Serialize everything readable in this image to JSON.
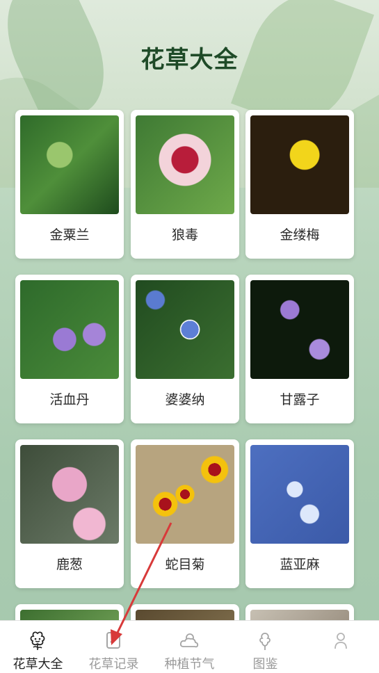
{
  "header": {
    "title": "花草大全"
  },
  "plants": [
    {
      "name": "金粟兰"
    },
    {
      "name": "狼毒"
    },
    {
      "name": "金缕梅"
    },
    {
      "name": "活血丹"
    },
    {
      "name": "婆婆纳"
    },
    {
      "name": "甘露子"
    },
    {
      "name": "鹿葱"
    },
    {
      "name": "蛇目菊"
    },
    {
      "name": "蓝亚麻"
    }
  ],
  "bottom_nav": [
    {
      "label": "花草大全",
      "icon": "flower-icon",
      "active": true
    },
    {
      "label": "花草记录",
      "icon": "notebook-icon",
      "active": false
    },
    {
      "label": "种植节气",
      "icon": "weather-icon",
      "active": false
    },
    {
      "label": "图鉴",
      "icon": "guide-icon",
      "active": false
    },
    {
      "label": "",
      "icon": "profile-icon",
      "active": false
    }
  ],
  "colors": {
    "accent": "#1e4a27",
    "arrow": "#d83a3a"
  }
}
